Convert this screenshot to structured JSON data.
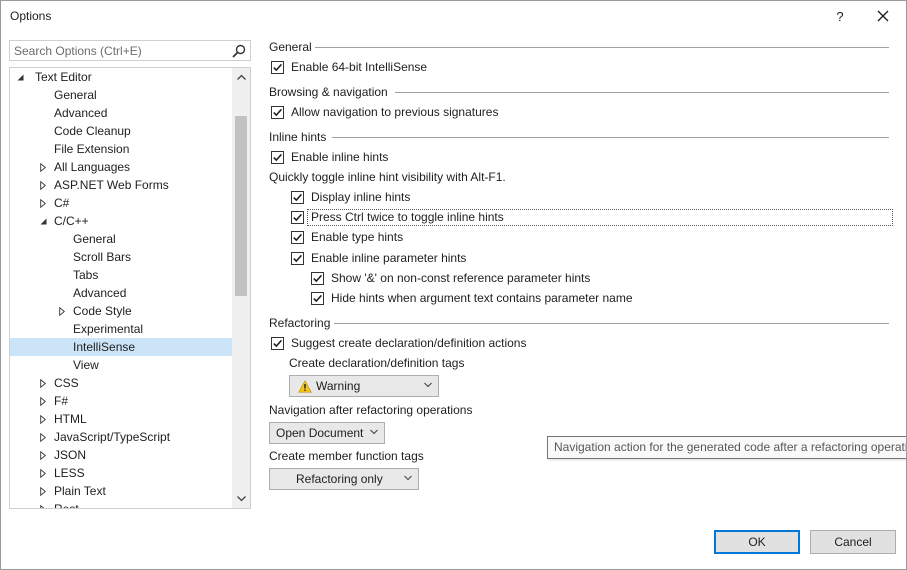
{
  "window": {
    "title": "Options",
    "help_label": "?"
  },
  "search": {
    "placeholder": "Search Options (Ctrl+E)"
  },
  "tree": {
    "items": [
      {
        "label": "Text Editor",
        "depth": 0,
        "arrow": "expanded"
      },
      {
        "label": "General",
        "depth": 1,
        "arrow": "none"
      },
      {
        "label": "Advanced",
        "depth": 1,
        "arrow": "none"
      },
      {
        "label": "Code Cleanup",
        "depth": 1,
        "arrow": "none"
      },
      {
        "label": "File Extension",
        "depth": 1,
        "arrow": "none"
      },
      {
        "label": "All Languages",
        "depth": 1,
        "arrow": "collapsed"
      },
      {
        "label": "ASP.NET Web Forms",
        "depth": 1,
        "arrow": "collapsed"
      },
      {
        "label": "C#",
        "depth": 1,
        "arrow": "collapsed"
      },
      {
        "label": "C/C++",
        "depth": 1,
        "arrow": "expanded"
      },
      {
        "label": "General",
        "depth": 2,
        "arrow": "none"
      },
      {
        "label": "Scroll Bars",
        "depth": 2,
        "arrow": "none"
      },
      {
        "label": "Tabs",
        "depth": 2,
        "arrow": "none"
      },
      {
        "label": "Advanced",
        "depth": 2,
        "arrow": "none"
      },
      {
        "label": "Code Style",
        "depth": 2,
        "arrow": "collapsed"
      },
      {
        "label": "Experimental",
        "depth": 2,
        "arrow": "none"
      },
      {
        "label": "IntelliSense",
        "depth": 2,
        "arrow": "none",
        "selected": true
      },
      {
        "label": "View",
        "depth": 2,
        "arrow": "none"
      },
      {
        "label": "CSS",
        "depth": 1,
        "arrow": "collapsed"
      },
      {
        "label": "F#",
        "depth": 1,
        "arrow": "collapsed"
      },
      {
        "label": "HTML",
        "depth": 1,
        "arrow": "collapsed"
      },
      {
        "label": "JavaScript/TypeScript",
        "depth": 1,
        "arrow": "collapsed"
      },
      {
        "label": "JSON",
        "depth": 1,
        "arrow": "collapsed"
      },
      {
        "label": "LESS",
        "depth": 1,
        "arrow": "collapsed"
      },
      {
        "label": "Plain Text",
        "depth": 1,
        "arrow": "collapsed"
      },
      {
        "label": "Rest",
        "depth": 1,
        "arrow": "collapsed"
      }
    ]
  },
  "content": {
    "general": {
      "header": "General",
      "enable_64bit": {
        "label": "Enable 64-bit IntelliSense",
        "checked": true
      }
    },
    "browsing": {
      "header": "Browsing & navigation",
      "allow_nav": {
        "label": "Allow navigation to previous signatures",
        "checked": true
      }
    },
    "inline_hints": {
      "header": "Inline hints",
      "enable": {
        "label": "Enable inline hints",
        "checked": true
      },
      "toggle_note": "Quickly toggle inline hint visibility with Alt-F1.",
      "display": {
        "label": "Display inline hints",
        "checked": true
      },
      "press_ctrl": {
        "label": "Press Ctrl twice to toggle inline hints",
        "checked": true
      },
      "type_hints": {
        "label": "Enable type hints",
        "checked": true
      },
      "param_hints": {
        "label": "Enable inline parameter hints",
        "checked": true
      },
      "show_amp": {
        "label": "Show '&' on non-const reference parameter hints",
        "checked": true
      },
      "hide_hints": {
        "label": "Hide hints when argument text contains parameter name",
        "checked": true
      }
    },
    "refactoring": {
      "header": "Refactoring",
      "suggest": {
        "label": "Suggest create declaration/definition actions",
        "checked": true
      },
      "tags_label": "Create declaration/definition tags",
      "tags_value": "Warning",
      "nav_label": "Navigation after refactoring operations",
      "nav_value": "Open Document",
      "member_label": "Create member function tags",
      "member_value": "Refactoring only"
    }
  },
  "tooltip": {
    "text": "Navigation action for the generated code after a refactoring operation"
  },
  "buttons": {
    "ok": "OK",
    "cancel": "Cancel"
  },
  "colors": {
    "selection": "#cce4f7",
    "ok_border": "#0078d7",
    "warning": "#f5c518"
  }
}
